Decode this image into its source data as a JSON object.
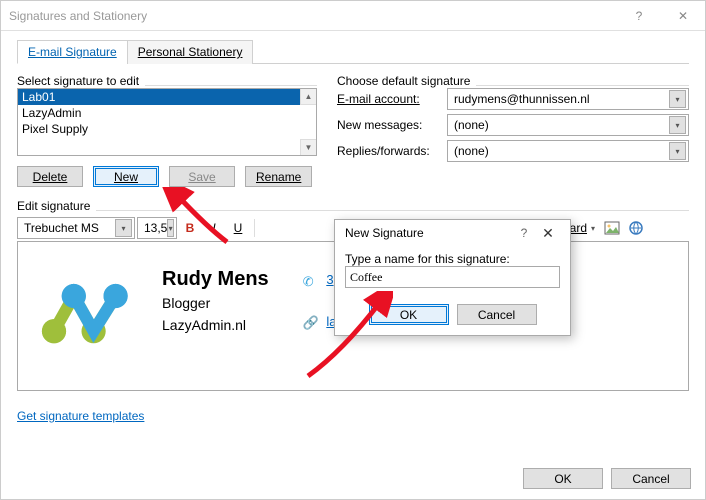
{
  "window": {
    "title": "Signatures and Stationery"
  },
  "tabs": {
    "email": "E-mail Signature",
    "stationery": "Personal Stationery"
  },
  "select_sig_label": "Select signature to edit",
  "signatures": [
    "Lab01",
    "LazyAdmin",
    "Pixel Supply"
  ],
  "buttons": {
    "delete": "Delete",
    "new": "New",
    "save": "Save",
    "rename": "Rename",
    "ok": "OK",
    "cancel": "Cancel"
  },
  "defaults": {
    "header": "Choose default signature",
    "account_label": "E-mail account:",
    "account_value": "rudymens@thunnissen.nl",
    "new_label": "New messages:",
    "new_value": "(none)",
    "reply_label": "Replies/forwards:",
    "reply_value": "(none)"
  },
  "edit_label": "Edit signature",
  "toolbar": {
    "font": "Trebuchet MS",
    "size": "13,5",
    "business_card": "Business Card"
  },
  "signature_preview": {
    "name": "Rudy Mens",
    "role": "Blogger",
    "site": "LazyAdmin.nl",
    "phone_link": "3",
    "web_link": "lazyadmin.nl"
  },
  "templates_link": "Get signature templates",
  "modal": {
    "title": "New Signature",
    "label": "Type a name for this signature:",
    "value": "Coffee",
    "ok": "OK",
    "cancel": "Cancel"
  }
}
